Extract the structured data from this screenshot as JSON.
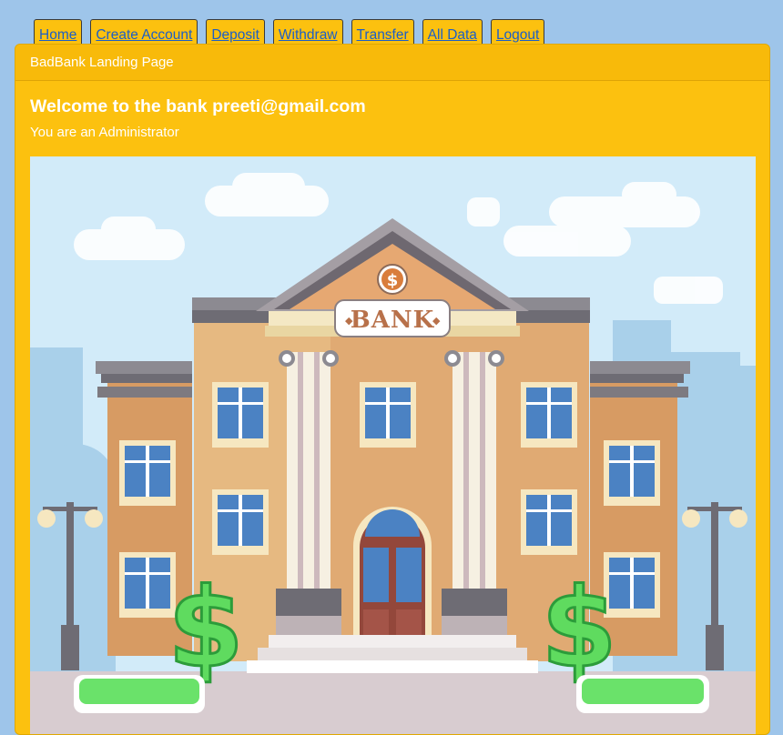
{
  "nav": {
    "items": [
      {
        "label": "Home"
      },
      {
        "label": "Create Account"
      },
      {
        "label": "Deposit"
      },
      {
        "label": "Withdraw"
      },
      {
        "label": "Transfer"
      },
      {
        "label": "All Data"
      },
      {
        "label": "Logout"
      }
    ]
  },
  "card": {
    "header": "BadBank Landing Page",
    "title": "Welcome to the bank preeti@gmail.com",
    "text": "You are an Administrator",
    "image": {
      "sign_text": "BANK",
      "medallion": "$"
    }
  },
  "colors": {
    "page_bg": "#9ec5ea",
    "card_bg": "#fcc10f",
    "link": "#1c5ec7",
    "text_on_card": "#ffffff"
  }
}
